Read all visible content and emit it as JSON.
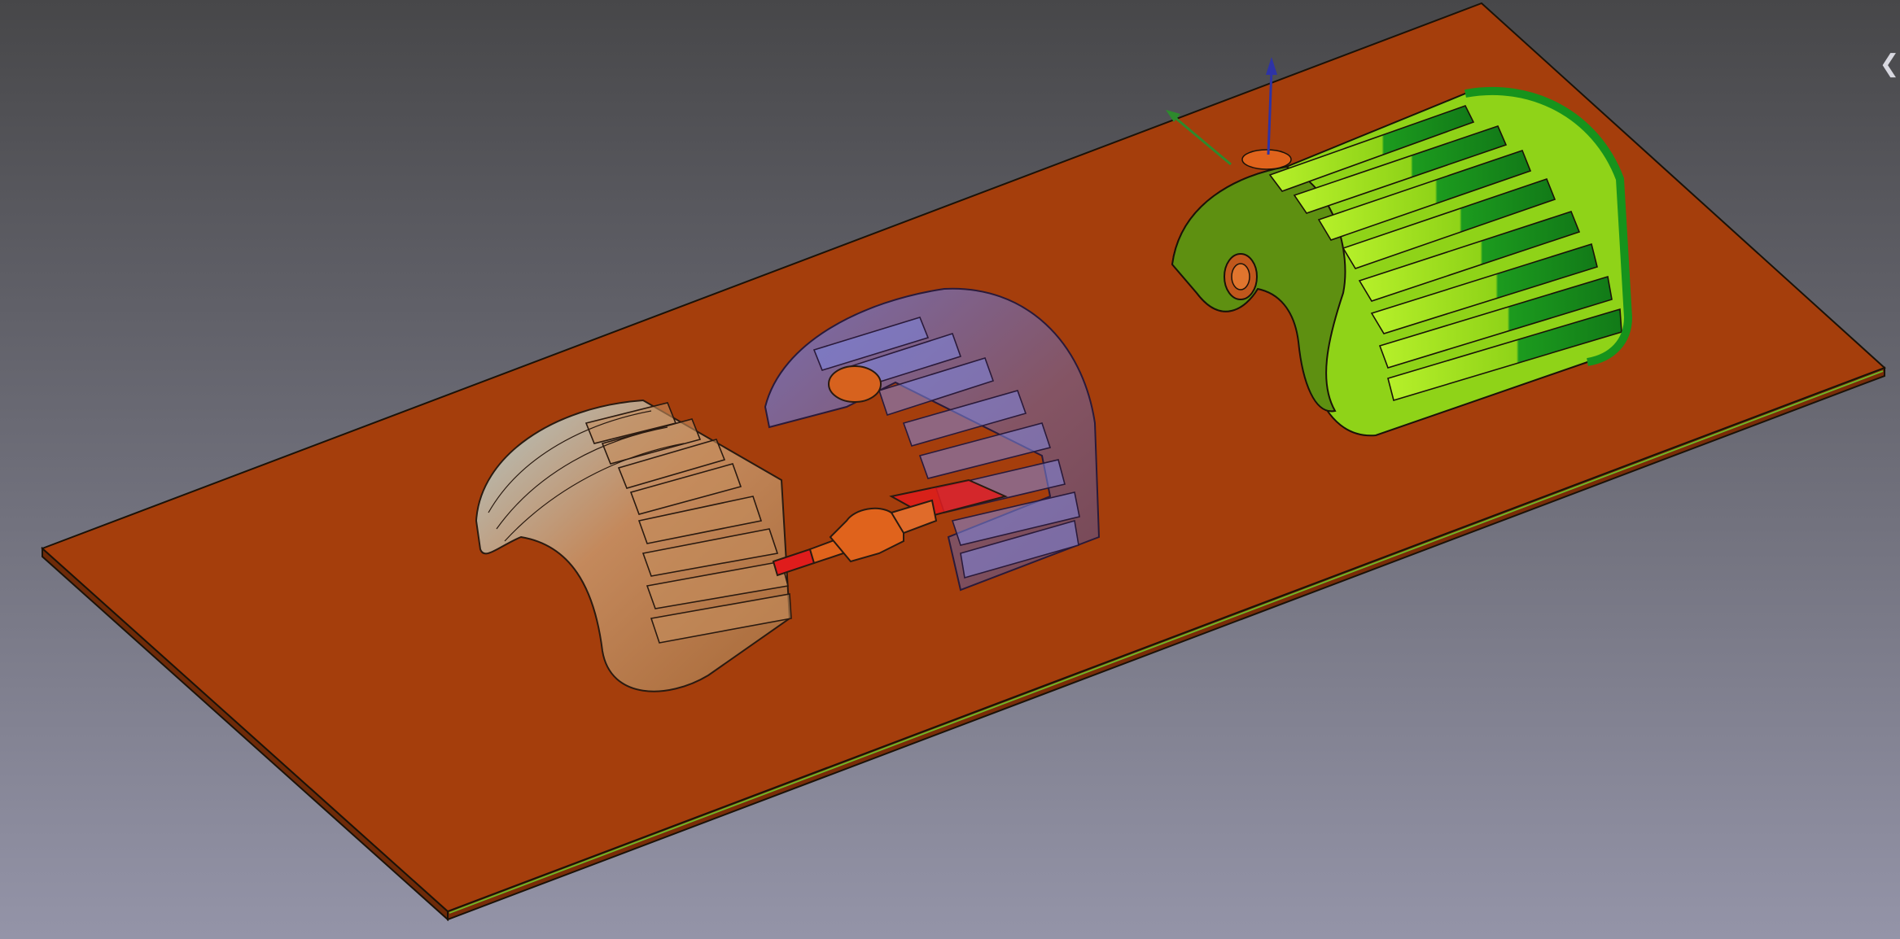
{
  "view": {
    "background_top": "#474749",
    "background_bottom": "#9494a8"
  },
  "colors": {
    "base_plate": "#a53e0c",
    "plate_edge": "#7a2c07",
    "plate_highlight": "#6fb527",
    "housing_green": "#8fd318",
    "housing_green_dark": "#16931c",
    "housing_green_side": "#5e9011",
    "housing_transparent_tan": "#c79466",
    "housing_transparent_cyan": "#aee4ea",
    "housing_transparent_purple": "#6a5a8c",
    "slot_blue": "#6c74dc",
    "shaft_orange": "#e0631c",
    "shaft_red": "#e01c1c",
    "outline": "#1a1208"
  },
  "axis": {
    "x_color": "#2d8a2d",
    "z_color": "#2e33a6"
  },
  "controls": {
    "side_panel_toggle_glyph": "❮"
  },
  "scene_objects": [
    {
      "name": "base-plate"
    },
    {
      "name": "housing-transparent-left"
    },
    {
      "name": "housing-transparent-center"
    },
    {
      "name": "shaft-coupling"
    },
    {
      "name": "housing-green-solid"
    },
    {
      "name": "axis-cross"
    }
  ]
}
